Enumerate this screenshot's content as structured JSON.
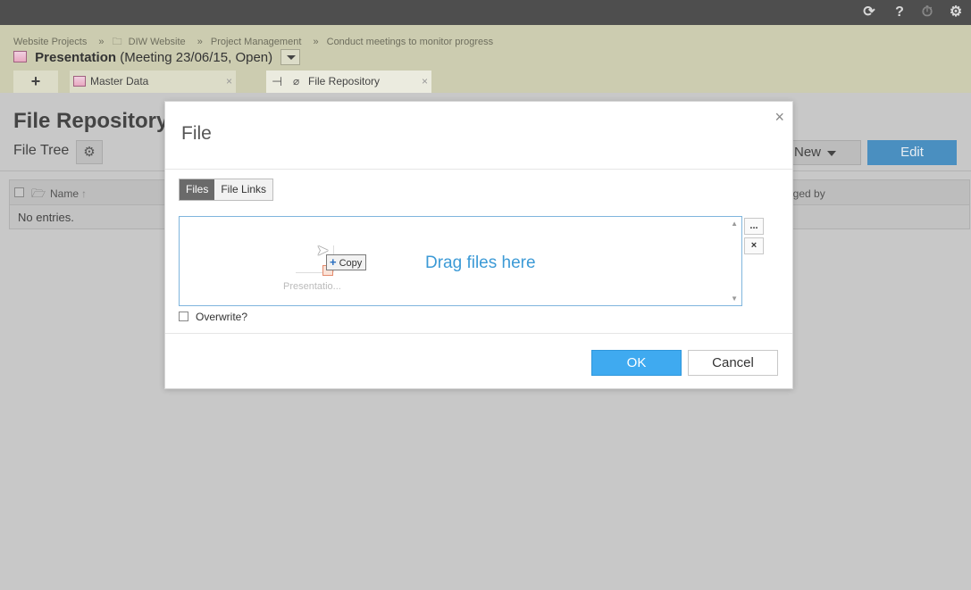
{
  "topbar": {
    "icons": [
      "sync-icon",
      "help-icon",
      "timer-icon",
      "settings-icon"
    ],
    "help_glyph": "?"
  },
  "breadcrumb": {
    "items": [
      "Website Projects",
      "DIW Website",
      "Project Management",
      "Conduct meetings to monitor progress"
    ],
    "separator": "»"
  },
  "header": {
    "title": "Presentation",
    "subtitle": "(Meeting 23/06/15, Open)"
  },
  "tabs": {
    "add_label": "+",
    "items": [
      {
        "label": "Master Data",
        "close": "×"
      },
      {
        "label": "File Repository",
        "close": "×"
      }
    ]
  },
  "page": {
    "title": "File Repository",
    "file_tree_label": "File Tree",
    "new_label": "New",
    "edit_label": "Edit"
  },
  "grid": {
    "columns": [
      "Name",
      "nged by"
    ],
    "sort_glyph": "↑",
    "empty_text": "No entries."
  },
  "modal": {
    "title": "File",
    "close": "×",
    "segments": [
      "Files",
      "File Links"
    ],
    "active_segment": "Files",
    "drop_text": "Drag files here",
    "drag_file_label": "Presentatio...",
    "copy_label": "Copy",
    "browse_label": "...",
    "clear_label": "×",
    "overwrite_label": "Overwrite?",
    "ok_label": "OK",
    "cancel_label": "Cancel"
  },
  "colors": {
    "accent": "#3faaf0",
    "drop_text": "#3c9ad6",
    "header_bg": "#ccccb0",
    "topbar_bg": "#4e4e4e"
  }
}
